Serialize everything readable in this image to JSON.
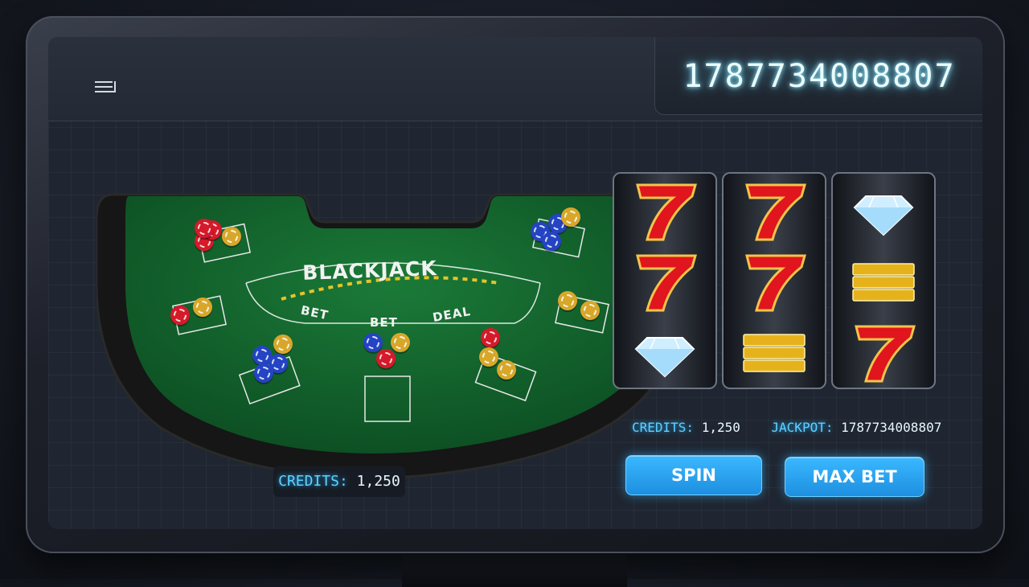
{
  "header": {
    "counter": "1787734008807"
  },
  "blackjack": {
    "title": "BLACKJACK",
    "labels": [
      "BET",
      "BET",
      "DEAL"
    ],
    "credits_label": "CREDITS:",
    "credits_value": "1,250"
  },
  "slots": {
    "reels": [
      [
        "seven-icon",
        "seven-icon",
        "diamond-icon"
      ],
      [
        "seven-icon",
        "seven-icon",
        "gold-bars-icon"
      ],
      [
        "diamond-icon",
        "gold-bars-icon",
        "seven-icon"
      ]
    ],
    "credits_label": "CREDITS:",
    "credits_value": "1,250",
    "jackpot_label": "JACKPOT:",
    "jackpot_value": "1787734008807",
    "spin_label": "SPIN",
    "max_bet_label": "MAX BET"
  },
  "colors": {
    "felt": "#0f5a2a",
    "accent_blue": "#2aa8f5",
    "seven_red": "#e0151d"
  }
}
